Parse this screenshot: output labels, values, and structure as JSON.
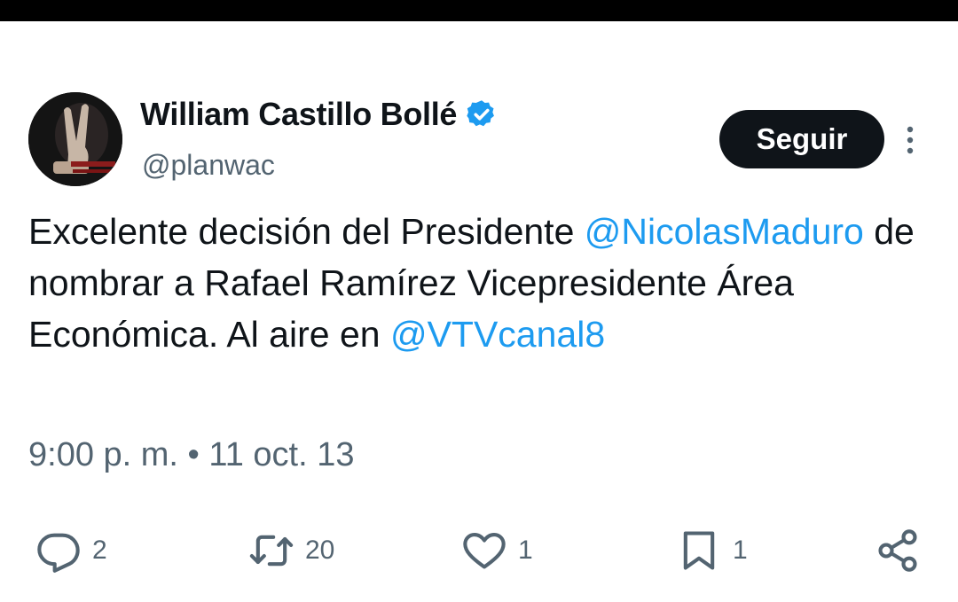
{
  "author": {
    "display_name": "William Castillo Bollé",
    "handle": "@planwac",
    "verified": true,
    "avatar_icon": "avatar-photo"
  },
  "follow_button": {
    "label": "Seguir"
  },
  "more_icon": "more-vertical-icon",
  "tweet": {
    "segments": [
      {
        "text": "Excelente decisión del Presidente ",
        "type": "text"
      },
      {
        "text": "@NicolasMaduro",
        "type": "mention"
      },
      {
        "text": " de nombrar a Rafael Ramírez Vicepresidente Área Económica. Al aire en ",
        "type": "text"
      },
      {
        "text": "@VTVcanal8",
        "type": "mention"
      }
    ]
  },
  "timestamp": "9:00 p. m. • 11 oct. 13",
  "actions": {
    "reply": {
      "icon": "reply-icon",
      "count": "2"
    },
    "retweet": {
      "icon": "retweet-icon",
      "count": "20"
    },
    "like": {
      "icon": "heart-icon",
      "count": "1"
    },
    "bookmark": {
      "icon": "bookmark-icon",
      "count": "1"
    },
    "share": {
      "icon": "share-icon"
    }
  },
  "colors": {
    "text": "#0f1419",
    "secondary": "#536471",
    "accent": "#1d9bf0",
    "button_bg": "#0f1419"
  }
}
